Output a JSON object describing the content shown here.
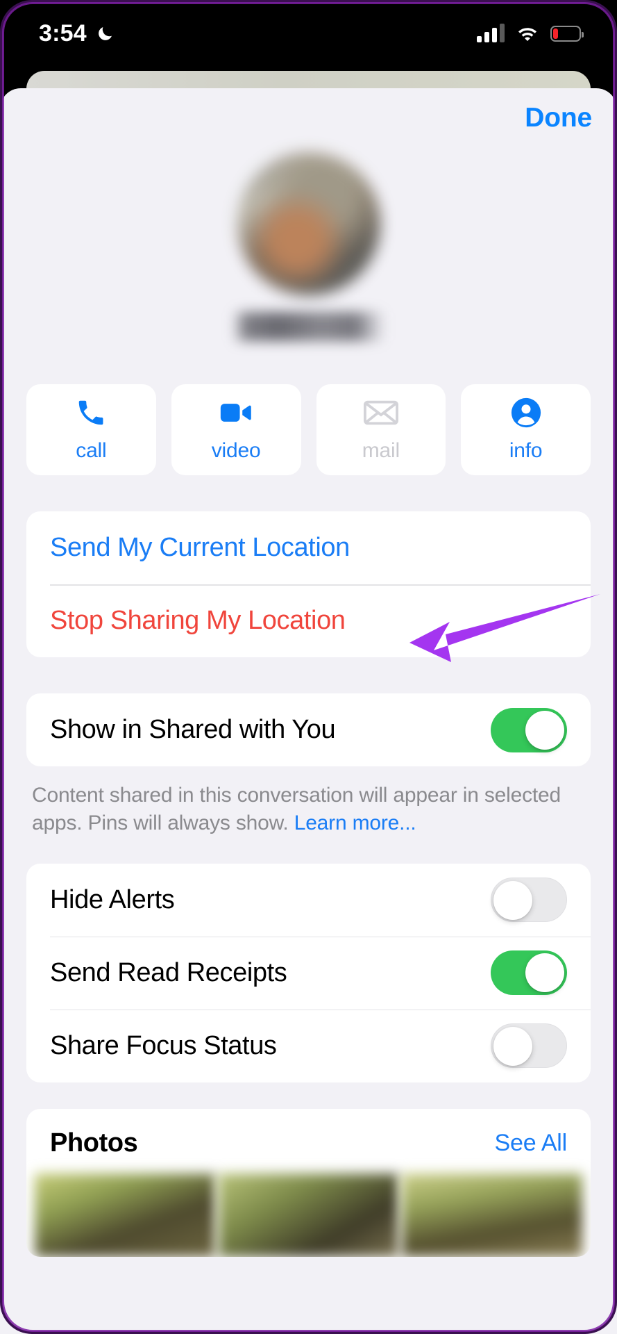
{
  "status_bar": {
    "time": "3:54",
    "focus_icon": "moon-icon",
    "signal_bars_filled": 3,
    "signal_bars_total": 4,
    "wifi_icon": "wifi-icon",
    "battery_icon": "battery-low-icon",
    "battery_percent": 20,
    "battery_color": "#f5232a"
  },
  "sheet": {
    "done_label": "Done",
    "accent_color": "#1a7df5",
    "destructive_color": "#f0453c",
    "toggle_on_color": "#34c759"
  },
  "contact": {
    "avatar": "blurred-contact-photo",
    "name": "blurred-contact-name"
  },
  "actions": [
    {
      "label": "call",
      "icon": "phone-icon",
      "enabled": true
    },
    {
      "label": "video",
      "icon": "video-camera-icon",
      "enabled": true
    },
    {
      "label": "mail",
      "icon": "envelope-icon",
      "enabled": false
    },
    {
      "label": "info",
      "icon": "person-circle-icon",
      "enabled": true
    }
  ],
  "location": {
    "send_current": "Send My Current Location",
    "stop_sharing": "Stop Sharing My Location"
  },
  "shared_with_you": {
    "label": "Show in Shared with You",
    "enabled": true,
    "footnote_text": "Content shared in this conversation will appear in selected apps. Pins will always show. ",
    "footnote_link": "Learn more..."
  },
  "settings": [
    {
      "label": "Hide Alerts",
      "enabled": false
    },
    {
      "label": "Send Read Receipts",
      "enabled": true
    },
    {
      "label": "Share Focus Status",
      "enabled": false
    }
  ],
  "photos": {
    "title": "Photos",
    "see_all": "See All",
    "thumbnails": [
      "blurred-photo-1",
      "blurred-photo-2",
      "blurred-photo-3"
    ]
  },
  "annotation": {
    "type": "arrow",
    "color": "#a435f0",
    "points_at": "Stop Sharing My Location"
  }
}
